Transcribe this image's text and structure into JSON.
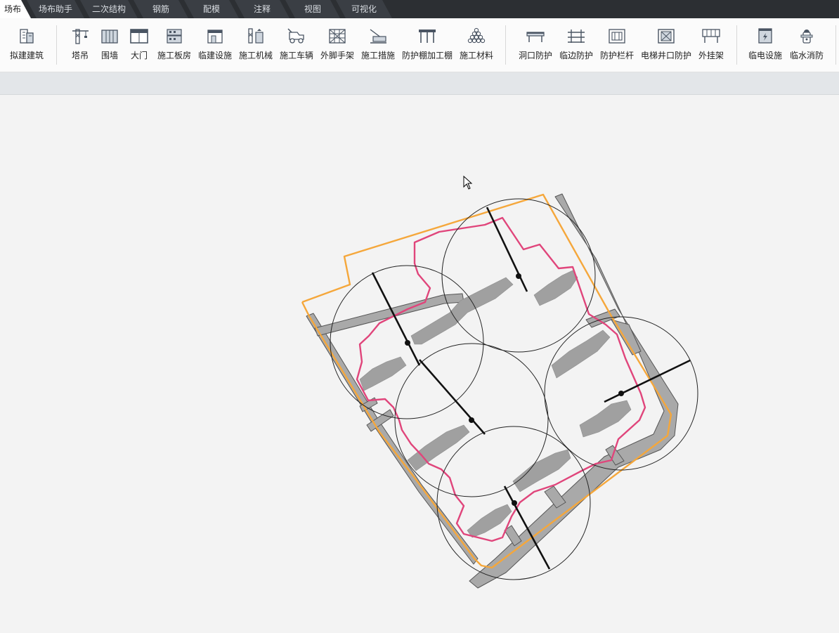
{
  "tabs": [
    {
      "label": "场布",
      "active": true
    },
    {
      "label": "场布助手"
    },
    {
      "label": "二次结构"
    },
    {
      "label": "钢筋"
    },
    {
      "label": "配模"
    },
    {
      "label": "注释"
    },
    {
      "label": "视图"
    },
    {
      "label": "可视化"
    }
  ],
  "ribbon": {
    "groups": [
      [
        {
          "label": "拟建建筑",
          "icon": "building-icon"
        }
      ],
      [
        {
          "label": "塔吊",
          "icon": "tower-crane-icon"
        },
        {
          "label": "围墙",
          "icon": "wall-icon"
        },
        {
          "label": "大门",
          "icon": "gate-icon"
        },
        {
          "label": "施工板房",
          "icon": "site-office-icon"
        },
        {
          "label": "临建设施",
          "icon": "temporary-facility-icon"
        },
        {
          "label": "施工机械",
          "icon": "construction-machinery-icon"
        },
        {
          "label": "施工车辆",
          "icon": "construction-vehicle-icon"
        },
        {
          "label": "外脚手架",
          "icon": "scaffold-icon"
        },
        {
          "label": "施工措施",
          "icon": "construction-measure-icon"
        },
        {
          "label": "防护棚加工棚",
          "icon": "protective-shed-icon"
        },
        {
          "label": "施工材料",
          "icon": "materials-icon"
        }
      ],
      [
        {
          "label": "洞口防护",
          "icon": "opening-protection-icon"
        },
        {
          "label": "临边防护",
          "icon": "edge-protection-icon"
        },
        {
          "label": "防护栏杆",
          "icon": "guardrail-icon"
        },
        {
          "label": "电梯井口防护",
          "icon": "elevator-shaft-protection-icon"
        },
        {
          "label": "外挂架",
          "icon": "external-frame-icon"
        }
      ],
      [
        {
          "label": "临电设施",
          "icon": "temporary-power-icon"
        },
        {
          "label": "临水消防",
          "icon": "fire-hydrant-icon"
        }
      ]
    ]
  },
  "colors": {
    "tabbar_bg": "#2c2f33",
    "site_boundary": "#f5a73b",
    "building_redline": "#e0457b",
    "road": "#a9a9a9",
    "building_footprint": "#a0a0a0",
    "crane_radius": "#222222",
    "canvas_bg": "#f3f3f3"
  }
}
